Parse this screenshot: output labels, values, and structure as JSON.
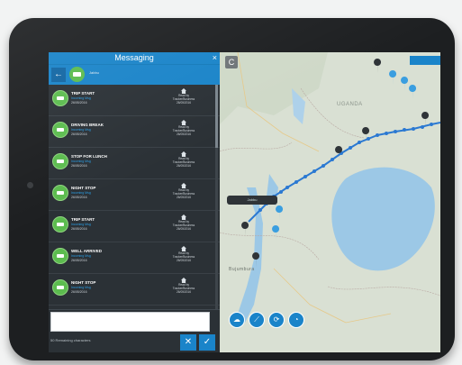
{
  "panel": {
    "title": "Messaging",
    "close_glyph": "×",
    "back_glyph": "←",
    "sub_label": "Jabbu"
  },
  "messages": [
    {
      "title": "TRIP START",
      "sub": "Incoming Msg",
      "date": "26/05/2016",
      "status": [
        "Read by",
        "Tracker/Business",
        "26/05/2016"
      ]
    },
    {
      "title": "DRIVING BREAK",
      "sub": "Incoming Msg",
      "date": "26/05/2016",
      "status": [
        "Read by",
        "Tracker/Business",
        "26/05/2016"
      ]
    },
    {
      "title": "STOP FOR LUNCH",
      "sub": "Incoming Msg",
      "date": "26/05/2016",
      "status": [
        "Read by",
        "Tracker/Business",
        "26/05/2016"
      ]
    },
    {
      "title": "NIGHT STOP",
      "sub": "Incoming Msg",
      "date": "26/05/2016",
      "status": [
        "Read by",
        "Tracker/Business",
        "26/05/2016"
      ]
    },
    {
      "title": "TRIP START",
      "sub": "Incoming Msg",
      "date": "26/05/2016",
      "status": [
        "Read by",
        "Tracker/Business",
        "26/05/2016"
      ]
    },
    {
      "title": "WELL ARRIVED",
      "sub": "Incoming Msg",
      "date": "26/05/2016",
      "status": [
        "Read by",
        "Tracker/Business",
        "26/05/2016"
      ]
    },
    {
      "title": "NIGHT STOP",
      "sub": "Incoming Msg",
      "date": "26/05/2016",
      "status": [
        "Read by",
        "Tracker/Business",
        "26/05/2016"
      ]
    }
  ],
  "compose": {
    "placeholder": "",
    "remaining": "50 Remaining characters",
    "cancel_glyph": "✕",
    "send_glyph": "✓"
  },
  "map": {
    "refresh_glyph": "C",
    "labels": {
      "uganda": "UGANDA",
      "bujumbura": "Bujumbura"
    },
    "tooltip": "Jabbu",
    "tools": [
      "cloud-icon",
      "route-icon",
      "refresh-circle-icon",
      "gauge-icon"
    ],
    "colors": {
      "accent": "#1a84c9",
      "lake": "#9cc8e6",
      "land": "#d6ddd1",
      "track": "#2b79d2"
    }
  }
}
